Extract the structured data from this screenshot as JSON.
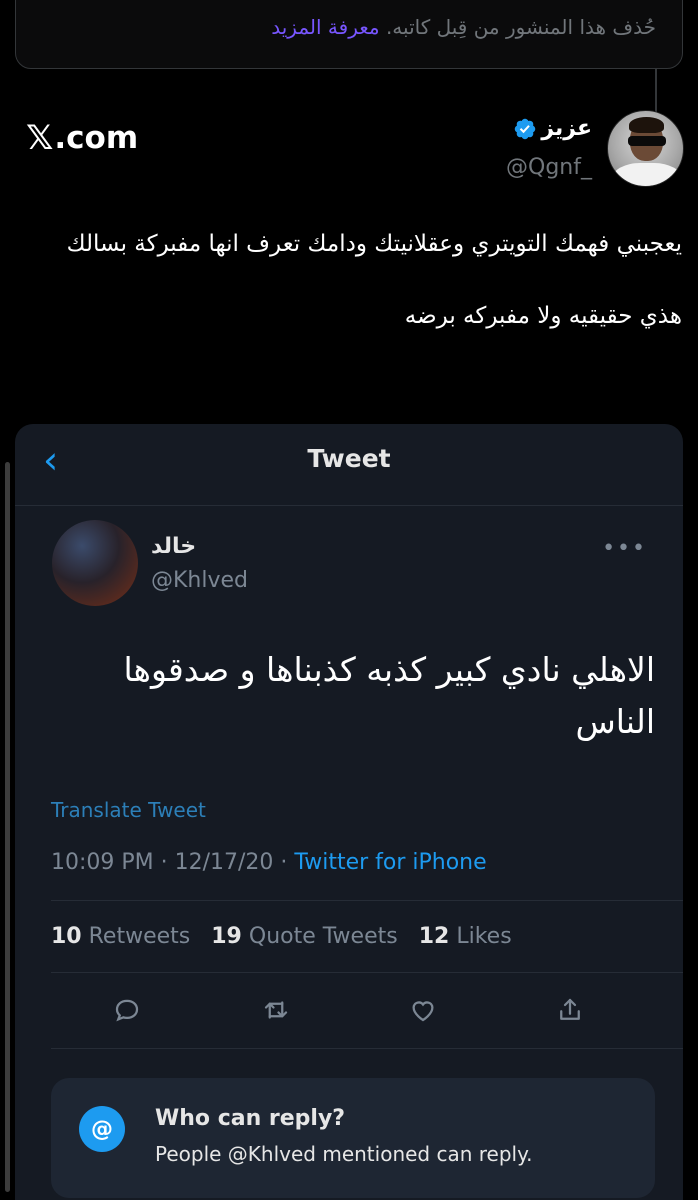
{
  "notice": {
    "text": "حُذف هذا المنشور من قِبل كاتبه.",
    "learn_more": "معرفة المزيد"
  },
  "author": {
    "name": "عزيز",
    "handle": "@Qgnf_",
    "verified": true
  },
  "branding": {
    "x_mark": "𝕏",
    "domain": ".com"
  },
  "tweet": {
    "lines": [
      "يعجبني فهمك التويتري وعقلانيتك ودامك تعرف انها مفبركة بسالك",
      "هذي حقيقيه ولا مفبركه برضه"
    ]
  },
  "embedded": {
    "nav_title": "Tweet",
    "author_name": "خالد",
    "author_handle": "@Khlved",
    "more": "•••",
    "text": "الاهلي نادي كبير كذبه كذبناها و صدقوها الناس",
    "translate": "Translate Tweet",
    "meta_time": "10:09 PM · 12/17/20 · ",
    "meta_source": "Twitter for iPhone",
    "stats": {
      "retweets_count": "10",
      "retweets_label": "Retweets",
      "quotes_count": "19",
      "quotes_label": "Quote Tweets",
      "likes_count": "12",
      "likes_label": "Likes"
    },
    "who_can_reply": {
      "icon": "@",
      "title": "Who can reply?",
      "subtitle": "People @Khlved mentioned can reply."
    }
  },
  "colors": {
    "background": "#000000",
    "accent": "#1d9bf0",
    "learn_more": "#7856ff",
    "muted": "#71767b"
  }
}
